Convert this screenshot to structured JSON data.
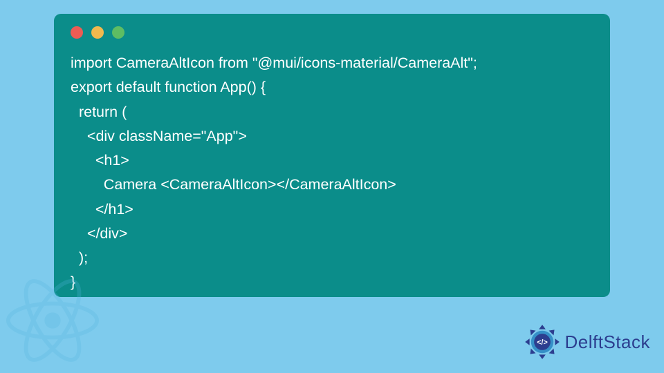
{
  "code": {
    "lines": [
      "import CameraAltIcon from \"@mui/icons-material/CameraAlt\";",
      "export default function App() {",
      "  return (",
      "    <div className=\"App\">",
      "      <h1>",
      "        Camera <CameraAltIcon></CameraAltIcon>",
      "      </h1>",
      "    </div>",
      "  );",
      "}"
    ]
  },
  "traffic": {
    "red": "#ec5c54",
    "yellow": "#f0b94e",
    "green": "#5ebd63"
  },
  "brand": {
    "name": "DelftStack"
  },
  "colors": {
    "page_bg": "#7ecbed",
    "card_bg": "#0b8d8a",
    "code_text": "#ffffff",
    "brand_text": "#2c3e8f"
  }
}
